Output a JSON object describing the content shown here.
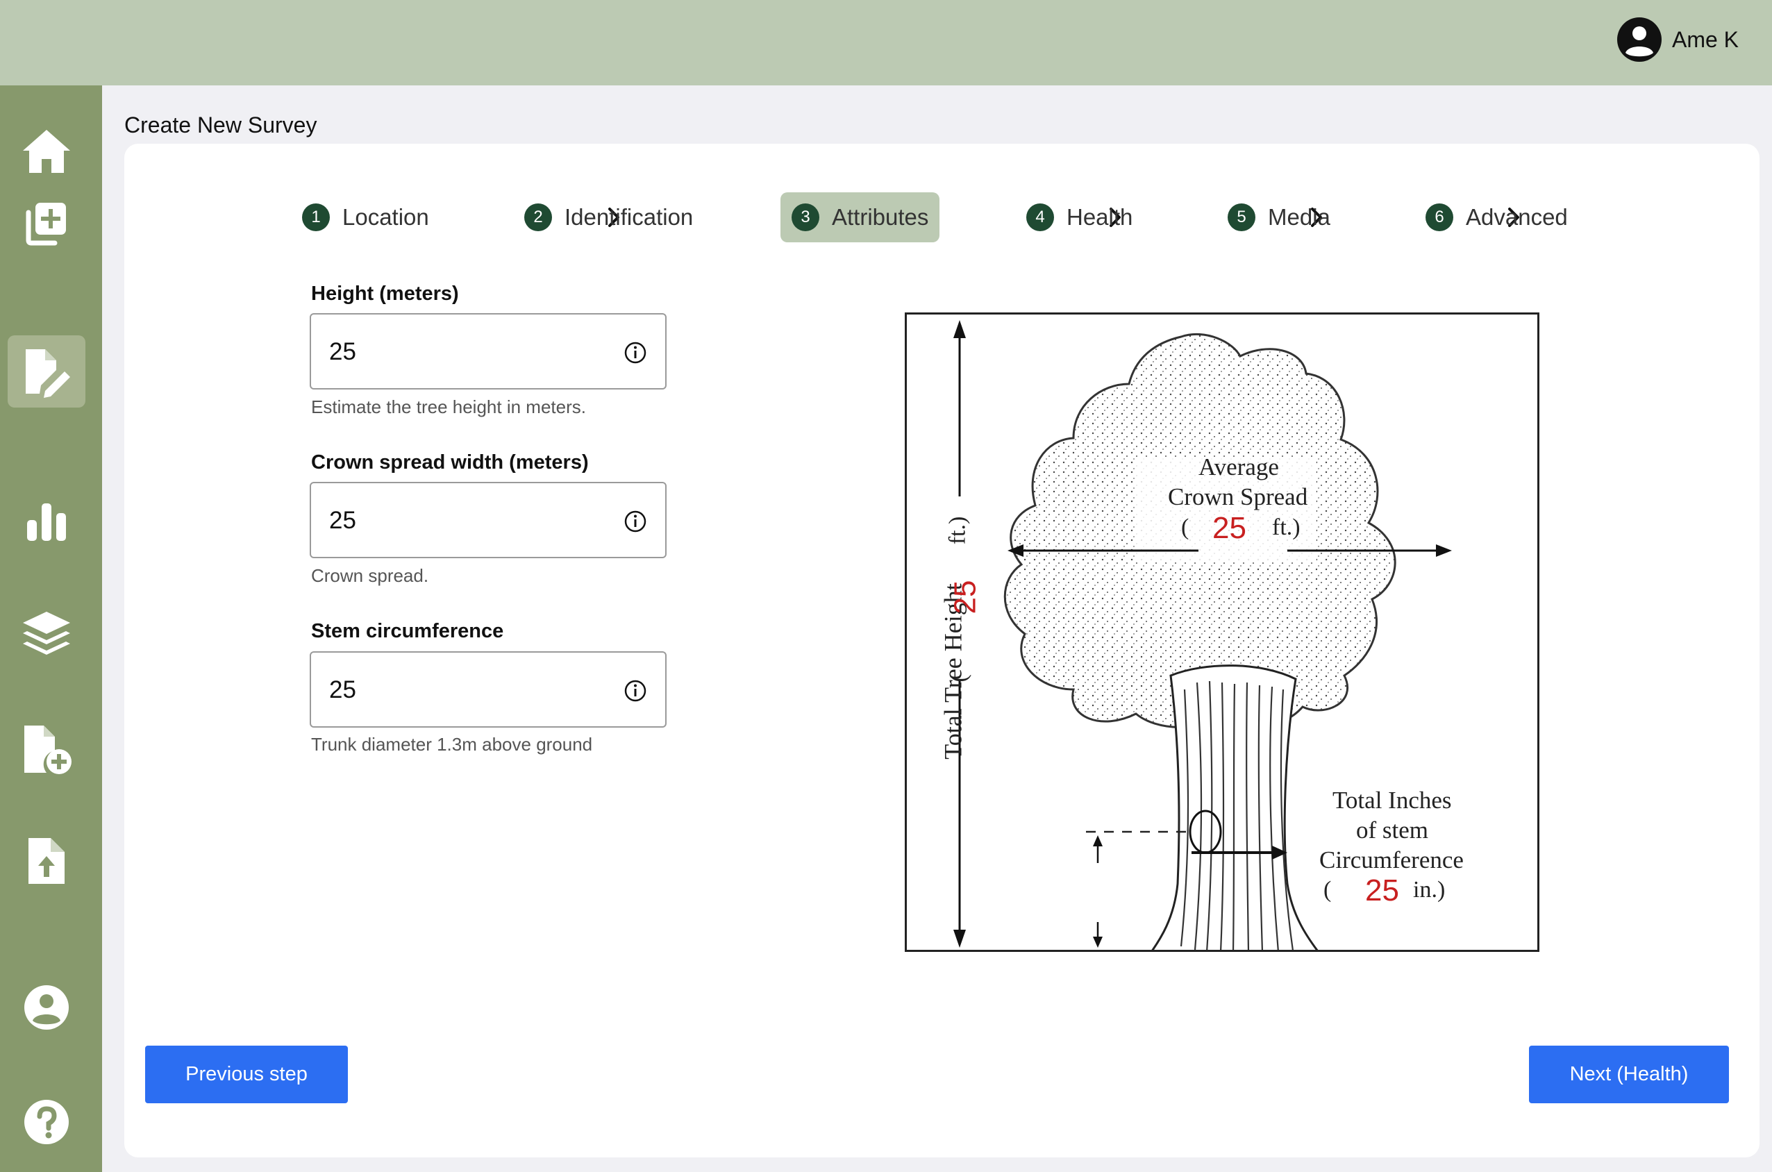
{
  "header": {
    "user_name": "Ame K",
    "user_icon": "user-circle-icon"
  },
  "sidebar": {
    "items": [
      {
        "name": "home",
        "icon": "home-icon"
      },
      {
        "name": "add-survey",
        "icon": "copy-plus-icon"
      },
      {
        "name": "edit-survey",
        "icon": "file-pen-icon",
        "active": true
      },
      {
        "name": "charts",
        "icon": "bar-chart-icon"
      },
      {
        "name": "layers",
        "icon": "layers-icon"
      },
      {
        "name": "new-file",
        "icon": "file-plus-icon"
      },
      {
        "name": "upload",
        "icon": "file-upload-icon"
      },
      {
        "name": "profile",
        "icon": "user-circle-icon"
      },
      {
        "name": "help",
        "icon": "question-circle-icon"
      }
    ]
  },
  "page": {
    "title": "Create New Survey"
  },
  "stepper": {
    "steps": [
      {
        "num": "1",
        "label": "Location"
      },
      {
        "num": "2",
        "label": "Identification"
      },
      {
        "num": "3",
        "label": "Attributes"
      },
      {
        "num": "4",
        "label": "Health"
      },
      {
        "num": "5",
        "label": "Media"
      },
      {
        "num": "6",
        "label": "Advanced"
      }
    ],
    "active": "Attributes"
  },
  "form": {
    "height": {
      "label": "Height (meters)",
      "value": "25",
      "help": "Estimate the tree height in meters."
    },
    "crown": {
      "label": "Crown spread width (meters)",
      "value": "25",
      "help": "Crown spread."
    },
    "stem": {
      "label": "Stem circumference",
      "value": "25",
      "help": "Trunk diameter 1.3m above ground"
    }
  },
  "diagram": {
    "height_label": "Total Tree Height",
    "height_open": "(",
    "height_unit": "ft.)",
    "height_value": "25",
    "crown_line1": "Average",
    "crown_line2": "Crown Spread",
    "crown_open": "(",
    "crown_unit": "ft.)",
    "crown_value": "25",
    "stem_line1": "Total Inches",
    "stem_line2": "of stem",
    "stem_line3": "Circumference",
    "stem_open": "(",
    "stem_unit": "in.)",
    "stem_value": "25",
    "value_color": "#c82020"
  },
  "actions": {
    "previous": "Previous step",
    "next": "Next (Health)"
  },
  "colors": {
    "topbar": "#bccab3",
    "sidebar": "#87996c",
    "step_active": "#bccab3",
    "step_badge": "#1f4a32",
    "primary_button": "#2c6ef2"
  }
}
